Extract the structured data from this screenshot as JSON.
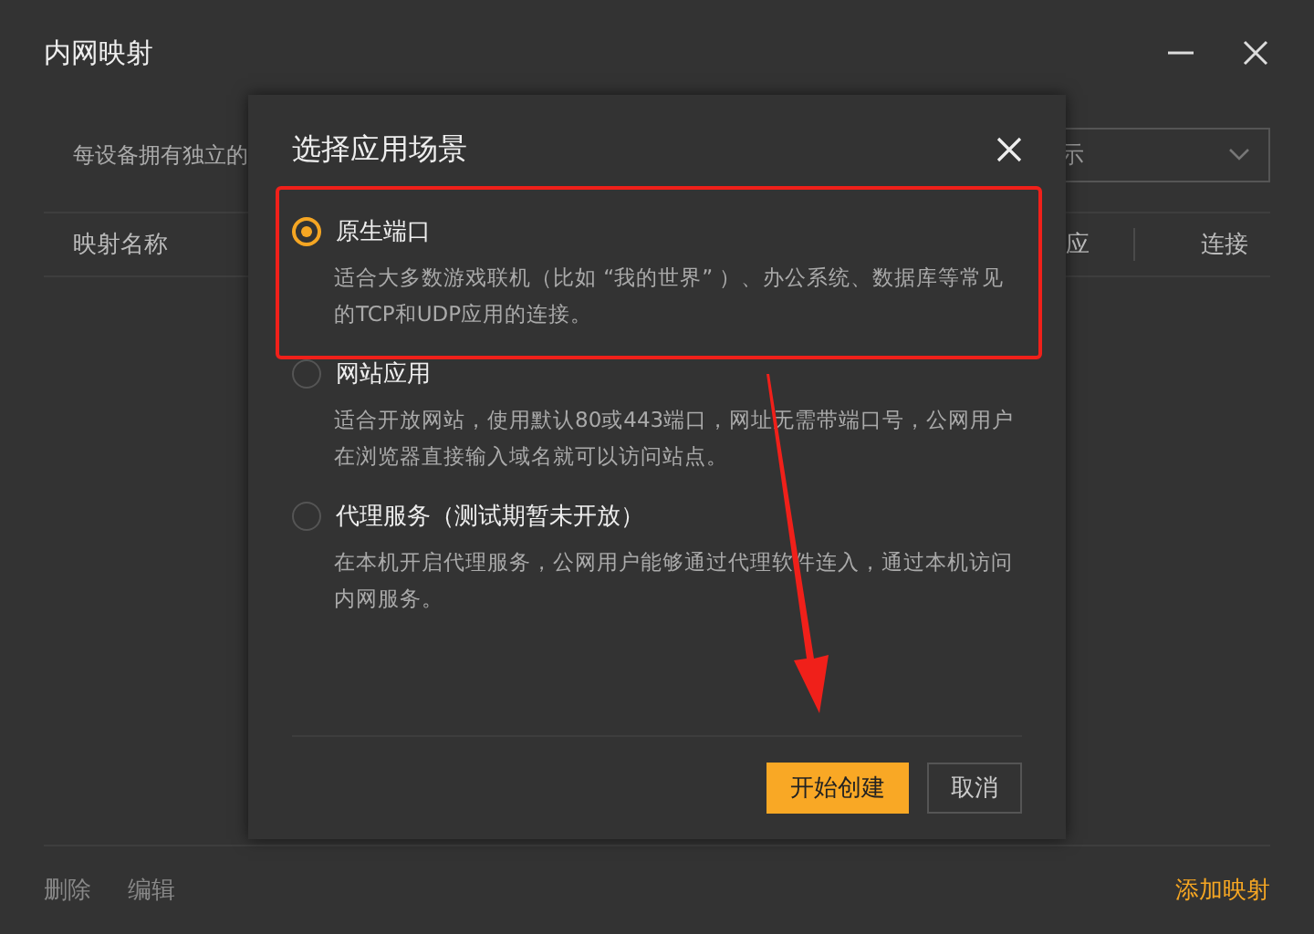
{
  "window": {
    "title": "内网映射"
  },
  "description": "每设备拥有独立的",
  "dropdown": {
    "value": "示"
  },
  "table": {
    "columns": [
      "映射名称",
      "应",
      "连接"
    ]
  },
  "footer": {
    "actions": [
      "删除",
      "编辑"
    ],
    "add": "添加映射"
  },
  "dialog": {
    "title": "选择应用场景",
    "options": [
      {
        "label": "原生端口",
        "description": "适合大多数游戏联机（比如 “我的世界” ）、办公系统、数据库等常见的TCP和UDP应用的连接。",
        "selected": true
      },
      {
        "label": "网站应用",
        "description": "适合开放网站，使用默认80或443端口，网址无需带端口号，公网用户在浏览器直接输入域名就可以访问站点。",
        "selected": false
      },
      {
        "label": "代理服务（测试期暂未开放）",
        "description": "在本机开启代理服务，公网用户能够通过代理软件连入，通过本机访问内网服务。",
        "selected": false
      }
    ],
    "buttons": [
      {
        "label": "开始创建",
        "kind": "primary"
      },
      {
        "label": "取消",
        "kind": "secondary"
      }
    ]
  }
}
